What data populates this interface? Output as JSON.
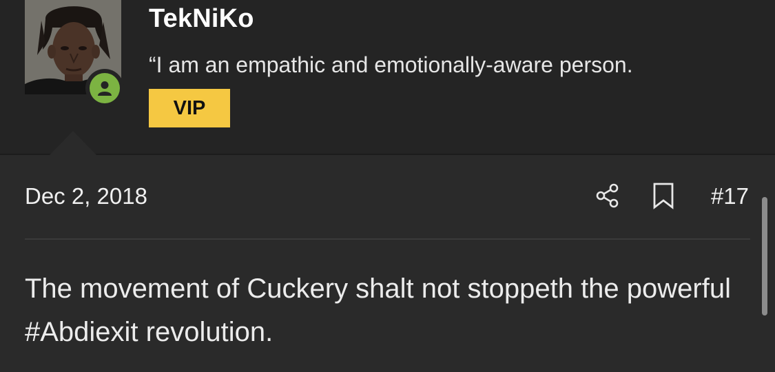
{
  "user": {
    "name": "TekNiKo",
    "title": "“I am an empathic and emotionally-aware person.",
    "badge": "VIP",
    "status": "online"
  },
  "post": {
    "date": "Dec 2, 2018",
    "number": "#17",
    "content": "The movement of Cuckery shalt not stoppeth the powerful #Abdiexit revolution."
  },
  "icons": {
    "share": "share-icon",
    "bookmark": "bookmark-icon",
    "online": "user-icon"
  },
  "colors": {
    "background": "#2a2a2a",
    "header_background": "#242424",
    "vip_badge": "#f5c842",
    "online_status": "#7cb342"
  }
}
